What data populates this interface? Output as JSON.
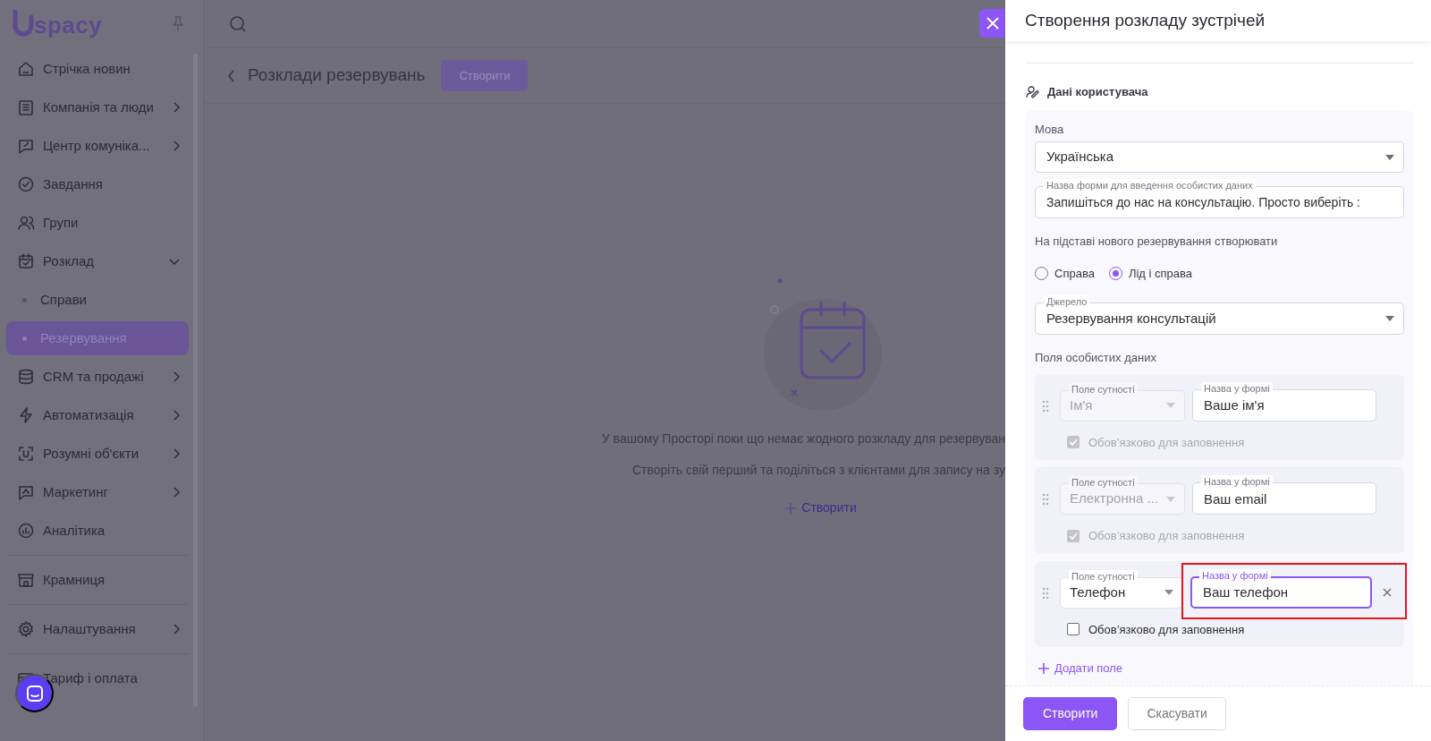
{
  "logo": {
    "text": "spacy"
  },
  "sidebar": {
    "groups": [
      {
        "items": [
          {
            "kind": "item",
            "label": "Стрічка новин",
            "expandable": false,
            "selected": false
          },
          {
            "kind": "item",
            "label": "Компанія та люди",
            "expandable": true,
            "expanded": false,
            "selected": false
          },
          {
            "kind": "item",
            "label": "Центр комуніка...",
            "expandable": true,
            "expanded": false,
            "selected": false
          },
          {
            "kind": "item",
            "label": "Завдання",
            "expandable": false,
            "selected": false
          },
          {
            "kind": "item",
            "label": "Групи",
            "expandable": false,
            "selected": false
          },
          {
            "kind": "item",
            "label": "Розклад",
            "expandable": true,
            "expanded": true,
            "selected": false
          },
          {
            "kind": "subitem",
            "label": "Справи",
            "expandable": false,
            "selected": false
          },
          {
            "kind": "subitem",
            "label": "Резервування",
            "expandable": false,
            "selected": true
          },
          {
            "kind": "item",
            "label": "CRM та продажі",
            "expandable": true,
            "expanded": false,
            "selected": false
          },
          {
            "kind": "item",
            "label": "Автоматизація",
            "expandable": true,
            "expanded": false,
            "selected": false
          },
          {
            "kind": "item",
            "label": "Розумні об'єкти",
            "expandable": true,
            "expanded": false,
            "selected": false
          },
          {
            "kind": "item",
            "label": "Маркетинг",
            "expandable": true,
            "expanded": false,
            "selected": false
          },
          {
            "kind": "item",
            "label": "Аналітика",
            "expandable": false,
            "selected": false
          }
        ]
      },
      {
        "items": [
          {
            "kind": "item",
            "label": "Крамниця",
            "expandable": false,
            "selected": false
          }
        ]
      },
      {
        "items": [
          {
            "kind": "item",
            "label": "Налаштування",
            "expandable": true,
            "expanded": false,
            "selected": false
          }
        ]
      },
      {
        "items": [
          {
            "kind": "item",
            "label": "Тариф і оплата",
            "expandable": false,
            "selected": false
          }
        ]
      }
    ]
  },
  "header": {
    "title": "Розклади резервувань",
    "create_button": "Створити"
  },
  "empty_state": {
    "lines": [
      "У вашому Просторі поки що немає жодного розкладу для резервуван",
      "Створіть свій перший та поділіться з клієнтами для запису на зу"
    ],
    "action": "Створити"
  },
  "panel": {
    "title": "Створення розкладу зустрічей",
    "section_title": "Дані користувача",
    "language": {
      "label": "Мова",
      "value": "Українська"
    },
    "form_name": {
      "label": "Назва форми для введення особистих даних",
      "value": "Запишіться до нас на консультацію. Просто виберіть :"
    },
    "create_basis": {
      "label": "На підставі нового резервування створювати",
      "options": [
        {
          "label": "Справа",
          "selected": false
        },
        {
          "label": "Лід і справа",
          "selected": true
        }
      ]
    },
    "source": {
      "label": "Джерело",
      "value": "Резервування консультацій"
    },
    "personal_fields": {
      "label": "Поля особистих даних",
      "rows": [
        {
          "entity_label": "Поле сутності",
          "entity": "Ім'я",
          "entity_disabled": true,
          "name_label": "Назва у формі",
          "name": "Ваше ім'я",
          "focused": false,
          "removable": false,
          "required_label": "Обов’язково для заповнення",
          "required": true,
          "required_disabled": true
        },
        {
          "entity_label": "Поле сутності",
          "entity": "Електронна ...",
          "entity_disabled": true,
          "name_label": "Назва у формі",
          "name": "Ваш email",
          "focused": false,
          "removable": false,
          "required_label": "Обов’язково для заповнення",
          "required": true,
          "required_disabled": true
        },
        {
          "entity_label": "Поле сутності",
          "entity": "Телефон",
          "entity_disabled": false,
          "name_label": "Назва у формі",
          "name": "Ваш телефон",
          "focused": true,
          "removable": true,
          "required_label": "Обов’язково для заповнення",
          "required": false,
          "required_disabled": false
        }
      ],
      "add": "Додати поле"
    },
    "buttons": {
      "submit": "Створити",
      "cancel": "Скасувати"
    }
  }
}
